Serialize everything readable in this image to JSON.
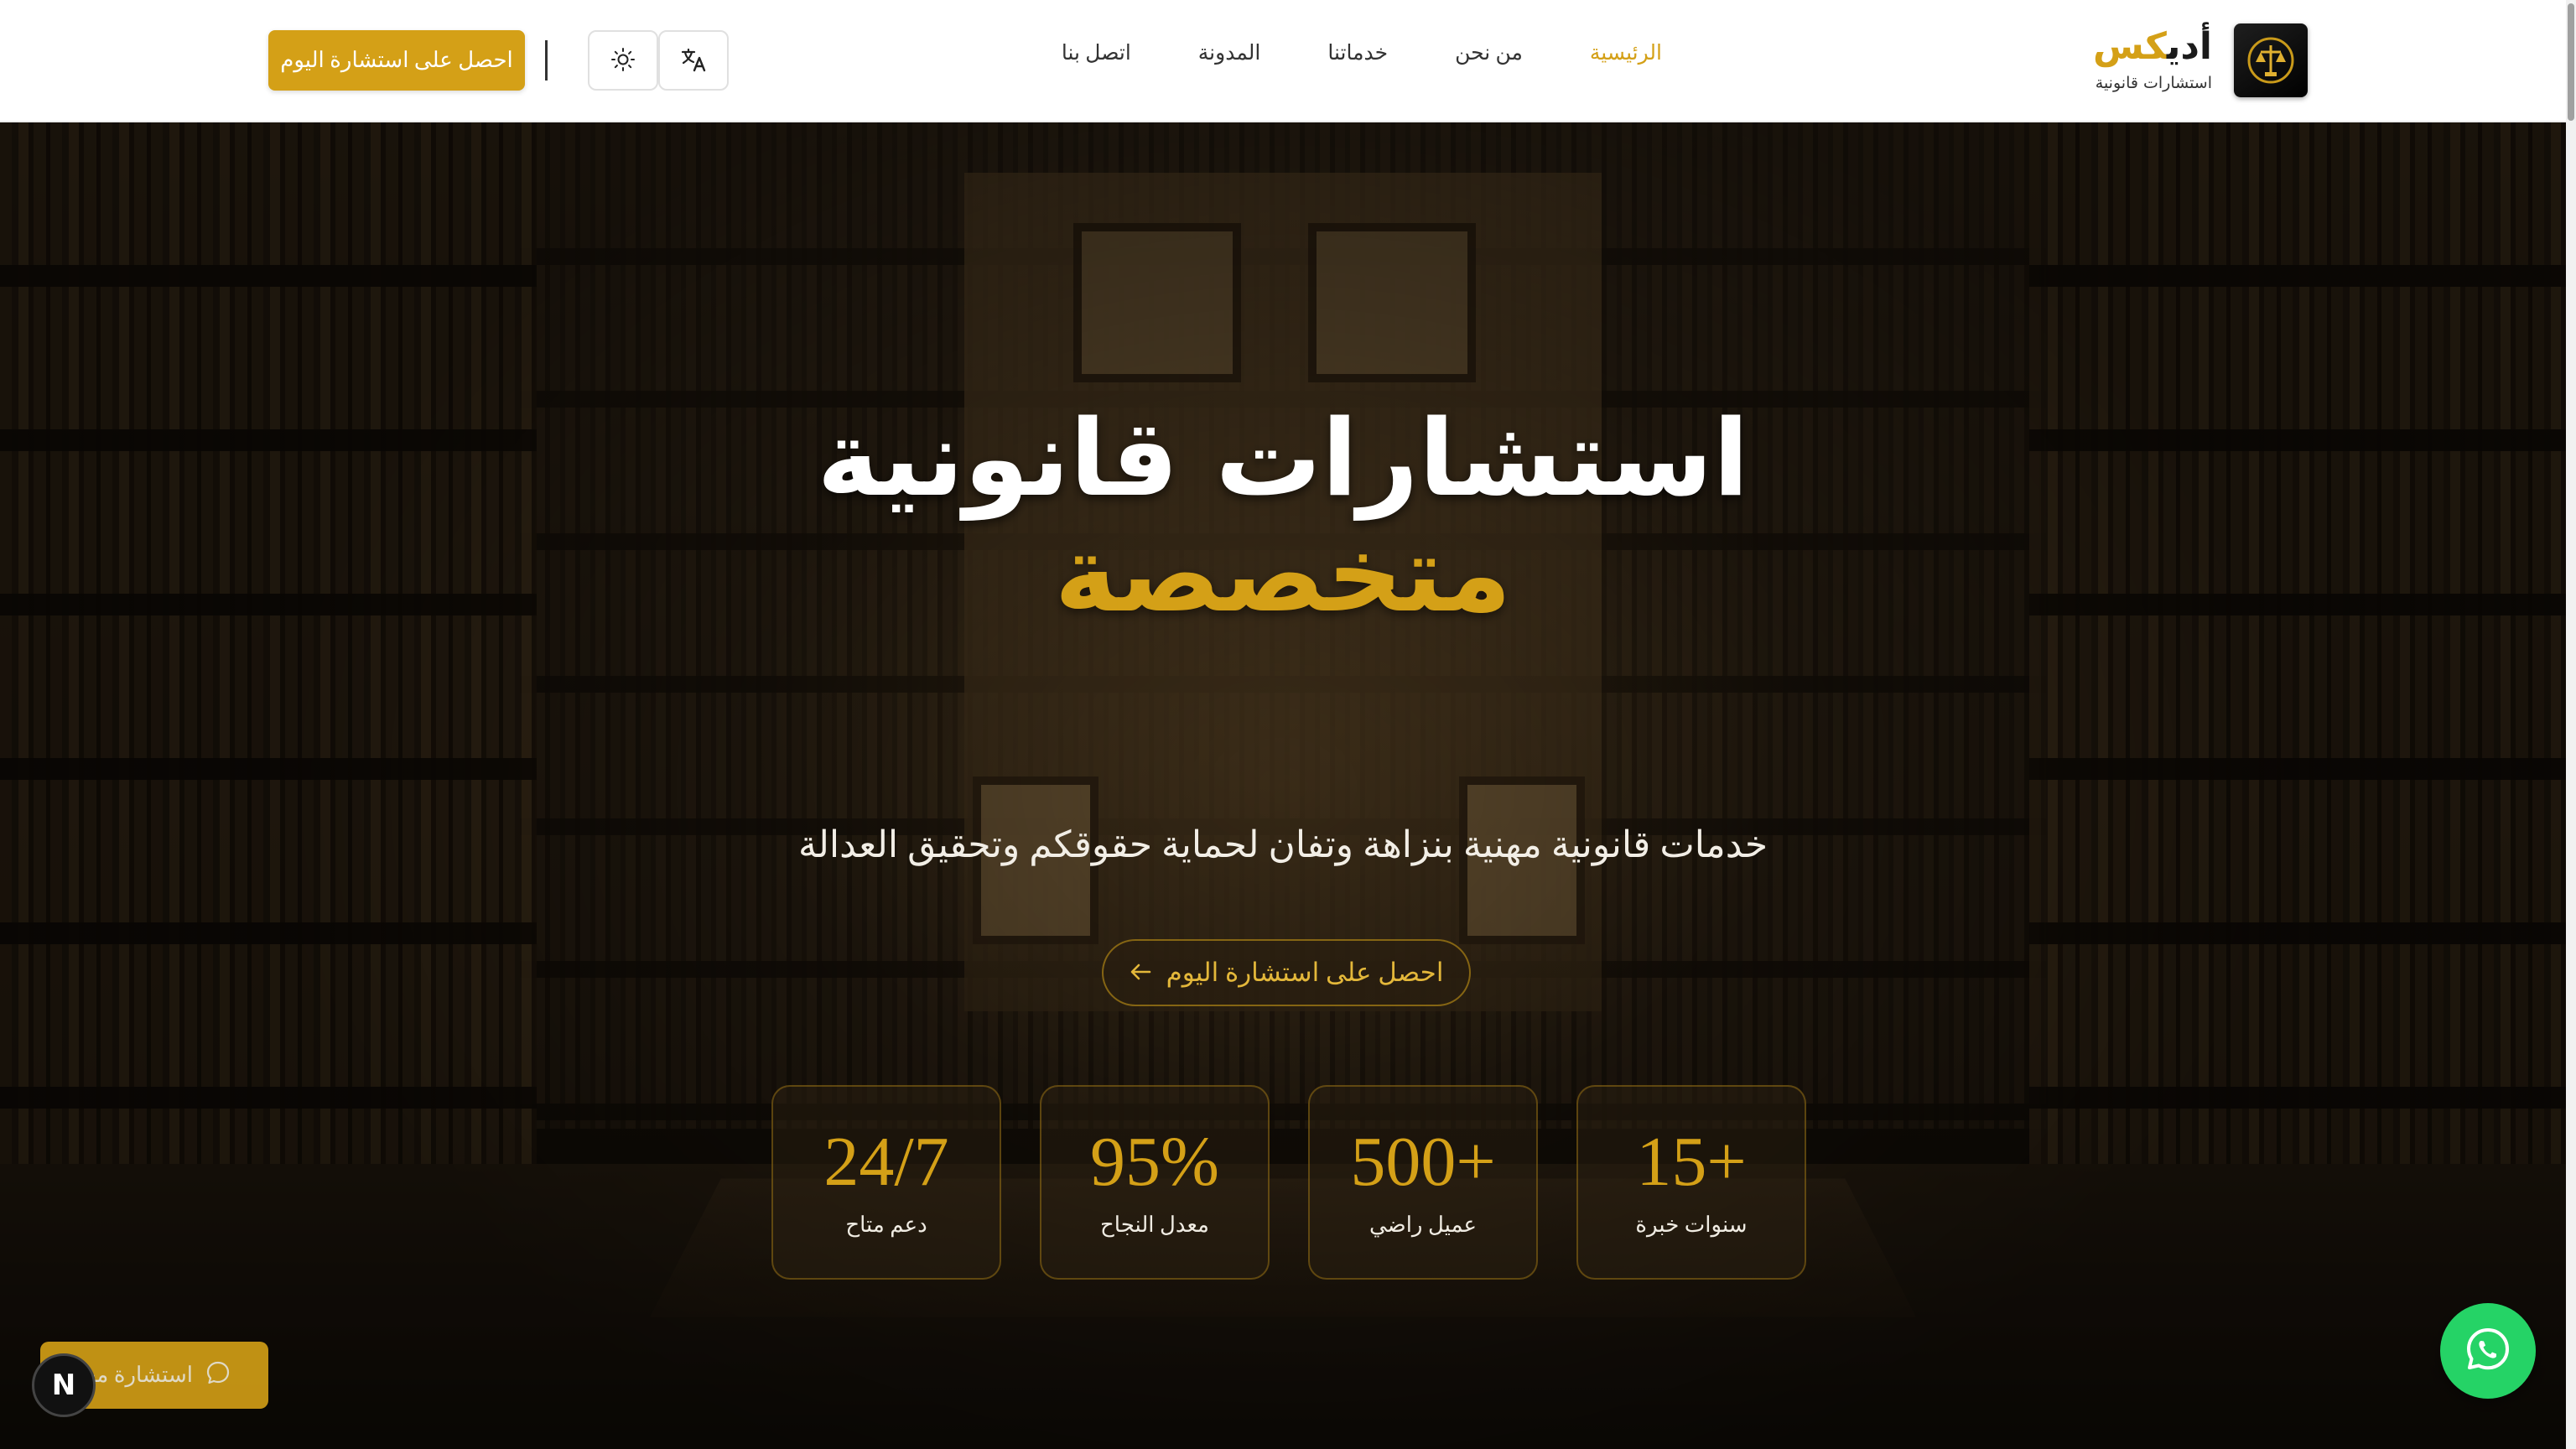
{
  "brand": {
    "name_part1": "أدي",
    "name_part2": "كس",
    "tagline": "استشارات قانونية",
    "emblem_icon": "scales-of-justice-icon"
  },
  "nav": {
    "items": [
      {
        "label": "الرئيسية",
        "active": true
      },
      {
        "label": "من نحن",
        "active": false
      },
      {
        "label": "خدماتنا",
        "active": false
      },
      {
        "label": "المدونة",
        "active": false
      },
      {
        "label": "اتصل بنا",
        "active": false
      }
    ]
  },
  "header_actions": {
    "cta_label": "احصل على استشارة اليوم",
    "theme_icon": "sun-icon",
    "language_icon": "translate-icon"
  },
  "hero": {
    "title_line1": "استشارات قانونية",
    "title_line2": "متخصصة",
    "subtitle": "خدمات قانونية مهنية بنزاهة وتفان لحماية حقوقكم وتحقيق العدالة",
    "cta_label": "احصل على استشارة اليوم",
    "cta_icon": "arrow-left-icon"
  },
  "stats": [
    {
      "value": "+15",
      "label": "سنوات خبرة"
    },
    {
      "value": "+500",
      "label": "عميل راضي"
    },
    {
      "value": "95%",
      "label": "معدل النجاح"
    },
    {
      "value": "24/7",
      "label": "دعم متاح"
    }
  ],
  "floating": {
    "consult_label": "استشارة مجانية",
    "consult_icon": "chat-bubble-icon",
    "whatsapp_icon": "whatsapp-icon",
    "n_badge": "N"
  },
  "colors": {
    "accent": "#d4a017",
    "whatsapp": "#25d366",
    "header_bg": "#ffffff"
  }
}
